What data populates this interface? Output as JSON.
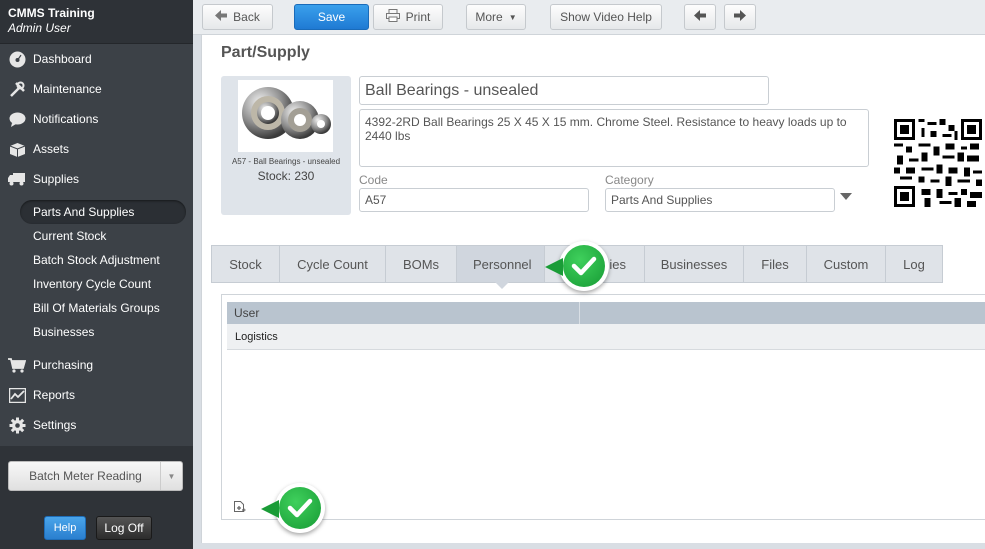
{
  "brand": {
    "app_name": "CMMS Training",
    "user": "Admin User"
  },
  "sidebar": {
    "items": [
      {
        "label": "Dashboard",
        "icon": "dashboard-icon"
      },
      {
        "label": "Maintenance",
        "icon": "tools-icon"
      },
      {
        "label": "Notifications",
        "icon": "chat-bubble-icon"
      },
      {
        "label": "Assets",
        "icon": "boxes-icon"
      },
      {
        "label": "Supplies",
        "icon": "truck-icon"
      }
    ],
    "supplies_sub": [
      "Parts And Supplies",
      "Current Stock",
      "Batch Stock Adjustment",
      "Inventory Cycle Count",
      "Bill Of Materials Groups",
      "Businesses"
    ],
    "items_lower": [
      {
        "label": "Purchasing",
        "icon": "cart-icon"
      },
      {
        "label": "Reports",
        "icon": "chart-icon"
      },
      {
        "label": "Settings",
        "icon": "gear-icon"
      }
    ],
    "batch_meter": "Batch Meter Reading",
    "help": "Help",
    "logoff": "Log Off"
  },
  "toolbar": {
    "back": "Back",
    "save": "Save",
    "print": "Print",
    "more": "More",
    "video_help": "Show Video Help"
  },
  "page": {
    "title": "Part/Supply",
    "image_caption": "A57 - Ball Bearings - unsealed",
    "stock": "Stock: 230",
    "name": "Ball Bearings - unsealed",
    "description": "4392-2RD Ball Bearings 25 X 45 X 15 mm. Chrome Steel. Resistance to heavy loads up to 2440 lbs",
    "code_label": "Code",
    "code_value": "A57",
    "category_label": "Category",
    "category_value": "Parts And Supplies"
  },
  "tabs": [
    {
      "label": "Stock"
    },
    {
      "label": "Cycle Count"
    },
    {
      "label": "BOMs"
    },
    {
      "label": "Personnel"
    },
    {
      "label": "ies"
    },
    {
      "label": "Businesses"
    },
    {
      "label": "Files"
    },
    {
      "label": "Custom"
    },
    {
      "label": "Log"
    }
  ],
  "grid": {
    "column_user": "User",
    "rows": [
      "Logistics"
    ]
  },
  "colors": {
    "sidebar_bg": "#3c4147",
    "accent_blue": "#1f7ad3",
    "callout_green": "#22b443"
  }
}
